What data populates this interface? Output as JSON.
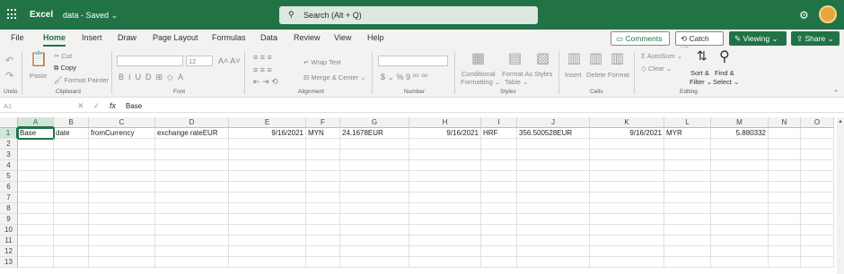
{
  "titlebar": {
    "app": "Excel",
    "doc": "data",
    "status": "Saved",
    "search_placeholder": "Search (Alt + Q)",
    "accent": "#217346"
  },
  "tabs": [
    "File",
    "Home",
    "Insert",
    "Draw",
    "Page Layout",
    "Formulas",
    "Data",
    "Review",
    "View",
    "Help"
  ],
  "active_tab": "Home",
  "actions": {
    "comments": "Comments",
    "catchup": "Catch up",
    "viewing": "Viewing",
    "share": "Share"
  },
  "ribbon": {
    "undo_label": "Undo",
    "clipboard": {
      "label": "Clipboard",
      "paste": "Paste",
      "cut": "Cut",
      "copy": "Copy",
      "format_painter": "Format Painter"
    },
    "font": {
      "label": "Font",
      "size": "12"
    },
    "alignment": {
      "label": "Alignment",
      "wrap": "Wrap Text",
      "merge": "Merge & Center"
    },
    "number": {
      "label": "Number"
    },
    "styles": {
      "label": "Styles",
      "conditional": "Conditional",
      "formatting": "Formatting",
      "format_as": "Format As",
      "table": "Table",
      "styles": "Styles"
    },
    "cells": {
      "label": "Cells",
      "insert": "Insert",
      "delete": "Delete",
      "format": "Format"
    },
    "editing": {
      "label": "Editing",
      "autosum": "AutoSum",
      "clear": "Clear",
      "sort": "Sort &",
      "filter": "Filter",
      "find": "Find &",
      "select": "Select"
    }
  },
  "formula_bar": {
    "name_box": "A1",
    "value": "Base"
  },
  "sheet": {
    "columns": [
      "A",
      "B",
      "C",
      "D",
      "E",
      "F",
      "G",
      "H",
      "I",
      "J",
      "K",
      "L",
      "M",
      "N",
      "O"
    ],
    "rows": [
      "1",
      "2",
      "3",
      "4",
      "5",
      "6",
      "7",
      "8",
      "9",
      "10",
      "11",
      "12",
      "13"
    ],
    "row1": {
      "A": "Base",
      "B": "date",
      "C": "fromCurrency",
      "D": "exchange rateEUR",
      "E": "9/16/2021",
      "F": "MYN",
      "G": "24.1678EUR",
      "H": "9/16/2021",
      "I": "HRF",
      "J": "356.500528EUR",
      "K": "9/16/2021",
      "L": "MYR",
      "M": "5.880332"
    }
  }
}
